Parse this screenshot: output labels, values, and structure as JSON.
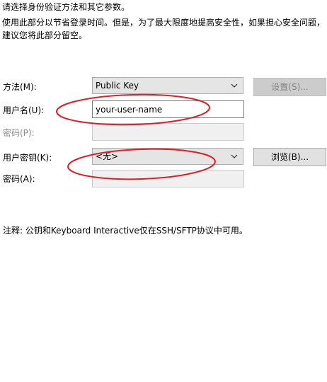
{
  "intro": {
    "line1": "请选择身份验证方法和其它参数。",
    "line2": "使用此部分以节省登录时间。但是，为了最大限度地提高安全性，如果担心安全问题，",
    "line3": "建议您将此部分留空。"
  },
  "method": {
    "label": "方法(M):",
    "value": "Public Key",
    "settings_button": "设置(S)..."
  },
  "username": {
    "label": "用户名(U):",
    "value": "your-user-name"
  },
  "password_disabled": {
    "label": "密码(P):",
    "value": ""
  },
  "user_key": {
    "label": "用户密钥(K):",
    "value": "<无>",
    "browse_button": "浏览(B)..."
  },
  "passphrase": {
    "label": "密码(A):",
    "value": ""
  },
  "note": "注释: 公钥和Keyboard Interactive仅在SSH/SFTP协议中可用。",
  "colors": {
    "annotation_ellipse": "#dd1f26",
    "disabled_button_bg": "#cccccc",
    "combo_bg": "#e5e5e5"
  }
}
